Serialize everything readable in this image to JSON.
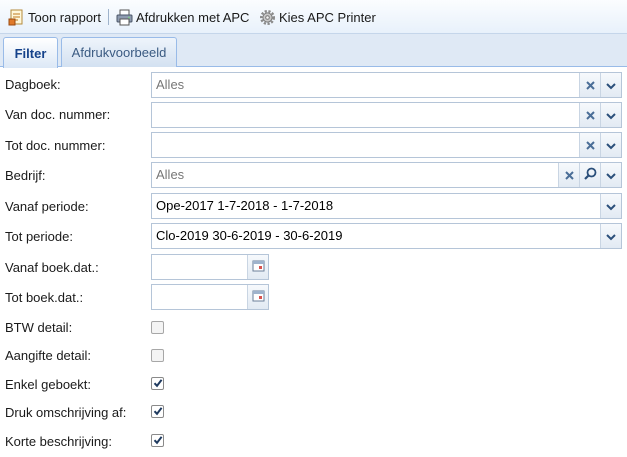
{
  "toolbar": {
    "show_report": "Toon rapport",
    "print_apc": "Afdrukken met APC",
    "choose_printer": "Kies APC Printer"
  },
  "tabs": [
    {
      "label": "Filter",
      "active": true
    },
    {
      "label": "Afdrukvoorbeeld",
      "active": false
    }
  ],
  "form": {
    "dagboek": {
      "label": "Dagboek:",
      "value": "Alles"
    },
    "van_doc": {
      "label": "Van doc. nummer:",
      "value": ""
    },
    "tot_doc": {
      "label": "Tot doc. nummer:",
      "value": ""
    },
    "bedrijf": {
      "label": "Bedrijf:",
      "value": "Alles"
    },
    "vanaf_periode": {
      "label": "Vanaf periode:",
      "value": "Ope-2017 1-7-2018 - 1-7-2018"
    },
    "tot_periode": {
      "label": "Tot periode:",
      "value": "Clo-2019 30-6-2019 - 30-6-2019"
    },
    "vanaf_boekdat": {
      "label": "Vanaf boek.dat.:",
      "value": ""
    },
    "tot_boekdat": {
      "label": "Tot boek.dat.:",
      "value": ""
    },
    "btw_detail": {
      "label": "BTW detail:",
      "checked": false
    },
    "aangifte_detail": {
      "label": "Aangifte detail:",
      "checked": false
    },
    "enkel_geboekt": {
      "label": "Enkel geboekt:",
      "checked": true
    },
    "druk_omschrijving": {
      "label": "Druk omschrijving af:",
      "checked": true
    },
    "korte_beschrijving": {
      "label": "Korte beschrijving:",
      "checked": true
    }
  },
  "colors": {
    "tab_active_text": "#15428b",
    "border": "#99bbe8",
    "toolbar_bg": "#e8f1fb"
  }
}
